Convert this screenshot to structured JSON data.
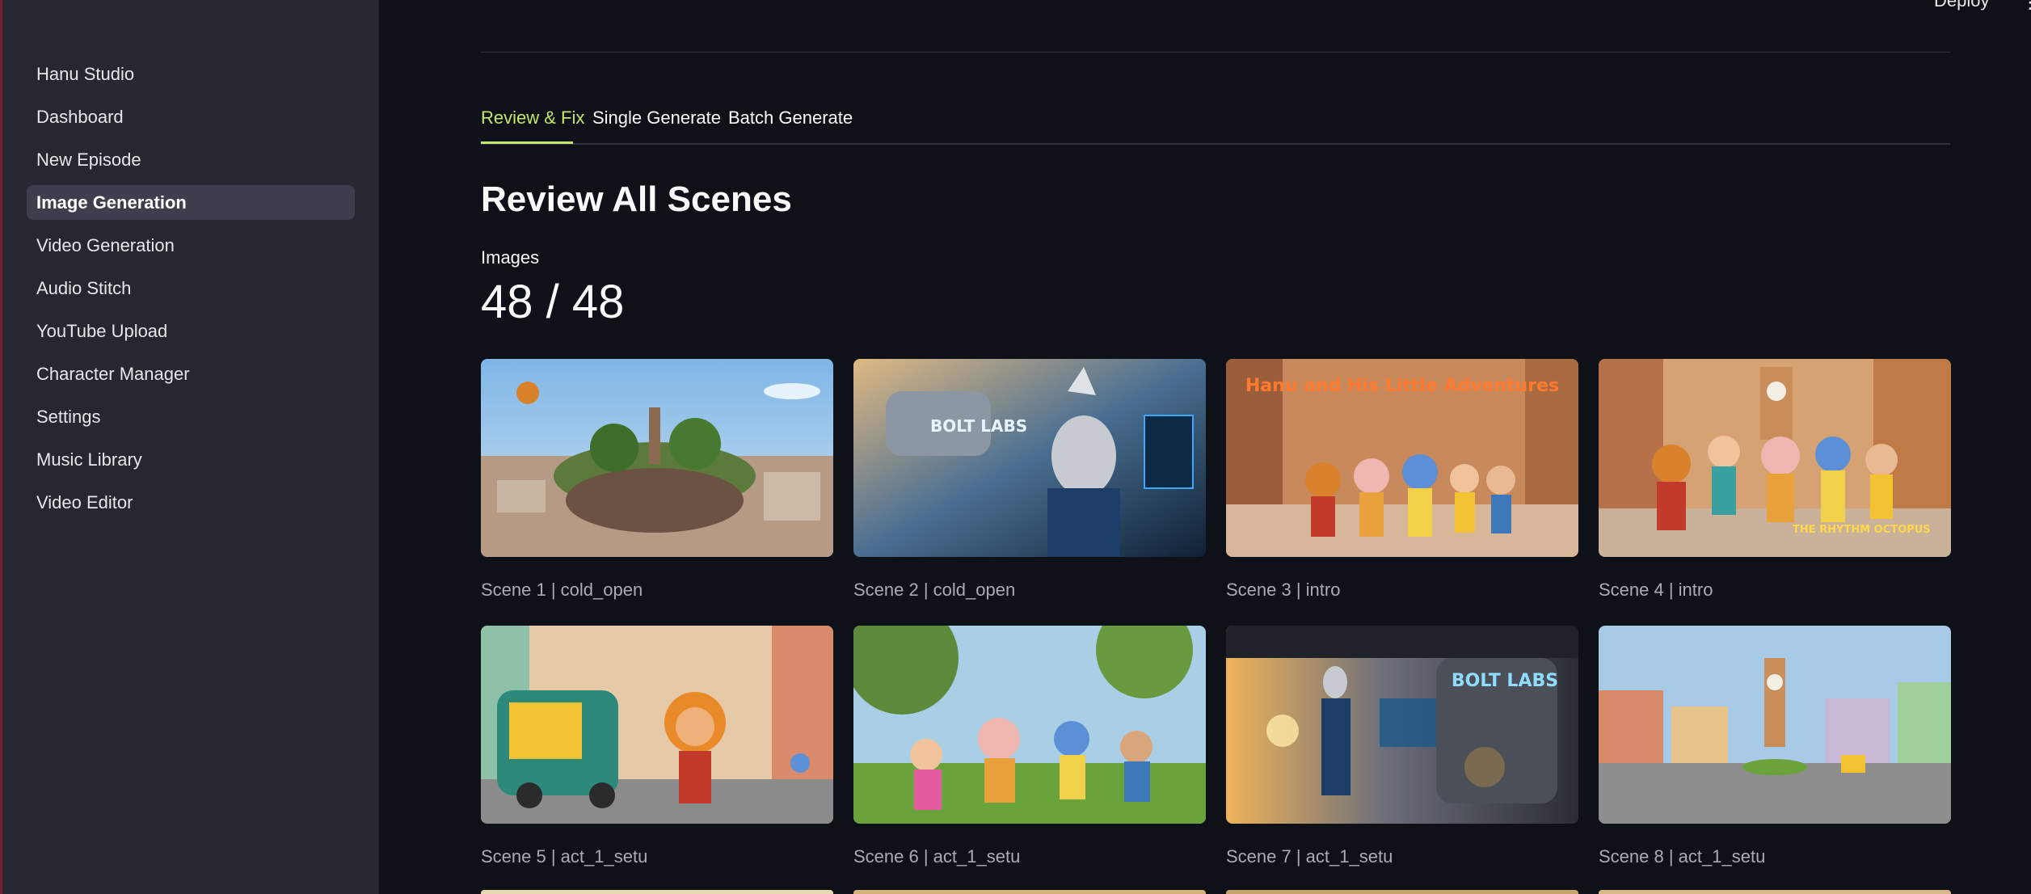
{
  "sidebar": {
    "items": [
      {
        "label": "Hanu Studio"
      },
      {
        "label": "Dashboard"
      },
      {
        "label": "New Episode"
      },
      {
        "label": "Image Generation",
        "active": true
      },
      {
        "label": "Video Generation"
      },
      {
        "label": "Audio Stitch"
      },
      {
        "label": "YouTube Upload"
      },
      {
        "label": "Character Manager"
      },
      {
        "label": "Settings"
      },
      {
        "label": "Music Library"
      },
      {
        "label": "Video Editor"
      }
    ]
  },
  "header": {
    "deploy_label": "Deploy",
    "menu_icon": "more-vertical-icon"
  },
  "tabs": [
    {
      "label": "Review & Fix",
      "active": true
    },
    {
      "label": "Single Generate"
    },
    {
      "label": "Batch Generate"
    }
  ],
  "main": {
    "heading": "Review All Scenes",
    "metric_label": "Images",
    "metric_value": "48 / 48"
  },
  "scenes": [
    {
      "caption": "Scene 1 | cold_open",
      "image_text": ""
    },
    {
      "caption": "Scene 2 | cold_open",
      "image_text": "BOLT LABS"
    },
    {
      "caption": "Scene 3 | intro",
      "image_text": "Hanu and His Little Adventures"
    },
    {
      "caption": "Scene 4 | intro",
      "image_text": "THE RHYTHM OCTOPUS"
    },
    {
      "caption": "Scene 5 | act_1_setu",
      "image_text": ""
    },
    {
      "caption": "Scene 6 | act_1_setu",
      "image_text": ""
    },
    {
      "caption": "Scene 7 | act_1_setu",
      "image_text": "BOLT LABS"
    },
    {
      "caption": "Scene 8 | act_1_setu",
      "image_text": ""
    }
  ],
  "colors": {
    "accent": "#c2e66b",
    "background": "#0e1117",
    "sidebar": "#262730"
  }
}
